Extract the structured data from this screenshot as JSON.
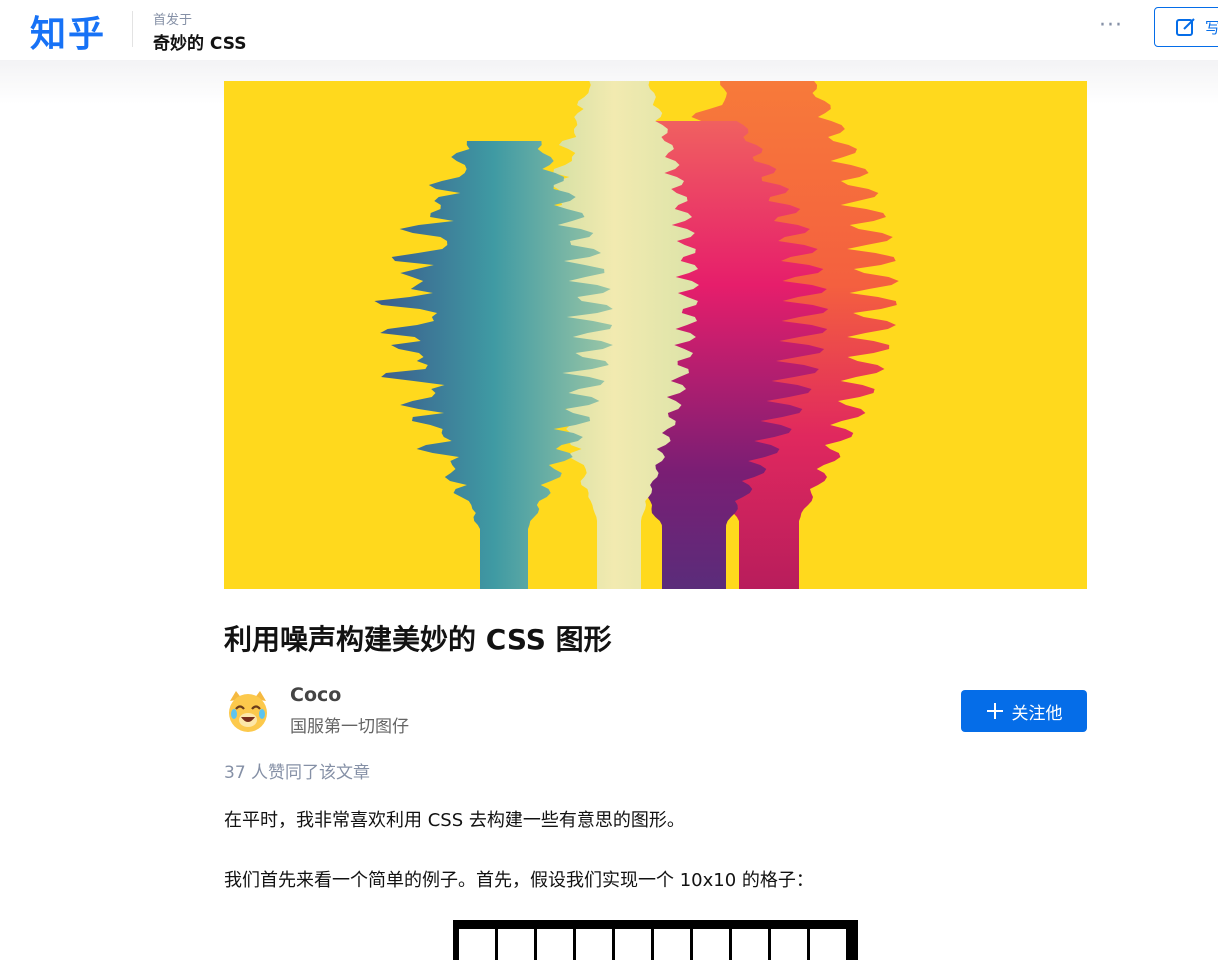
{
  "header": {
    "logo_text": "知乎",
    "column_prefix": "首发于",
    "column_name": "奇妙的 CSS",
    "more_label": "···",
    "write_label": "写"
  },
  "article": {
    "title": "利用噪声构建美妙的 CSS 图形",
    "author": {
      "name": "Coco",
      "bio": "国服第一切图仔",
      "avatar_icon": "laughing-dog-emoji-icon"
    },
    "follow_label": "关注他",
    "likes_text": "37 人赞同了该文章",
    "paragraphs": [
      "在平时，我非常喜欢利用 CSS 去构建一些有意思的图形。",
      "我们首先来看一个简单的例子。首先，假设我们实现一个 10x10 的格子："
    ]
  },
  "colors": {
    "brand_blue": "#1772f6",
    "button_blue": "#056de8",
    "cover_background": "#ffd91d"
  }
}
